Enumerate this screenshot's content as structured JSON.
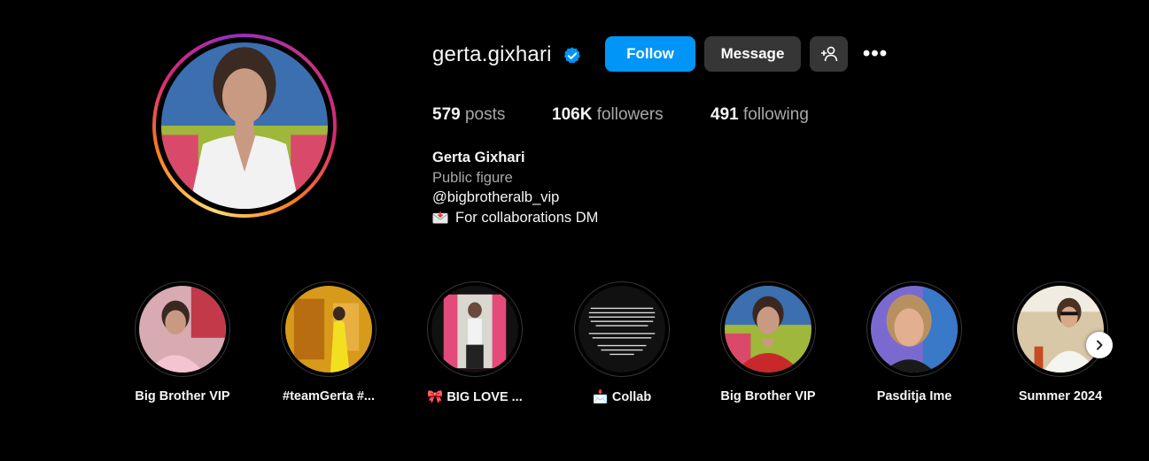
{
  "profile": {
    "username": "gerta.gixhari",
    "verified_icon": "verified-badge-icon",
    "buttons": {
      "follow": "Follow",
      "message": "Message",
      "add_user_icon": "add-user-icon",
      "more_icon": "more-options-icon",
      "more_glyph": "•••"
    },
    "stats": {
      "posts_count": "579",
      "posts_label": "posts",
      "followers_count": "106K",
      "followers_label": "followers",
      "following_count": "491",
      "following_label": "following"
    },
    "bio": {
      "name": "Gerta Gixhari",
      "category": "Public figure",
      "link": "@bigbrotheralb_vip",
      "text": "For collaborations DM"
    }
  },
  "highlights": [
    {
      "label": "Big Brother VIP"
    },
    {
      "label": "#teamGerta #..."
    },
    {
      "label": "🎀 BIG LOVE ..."
    },
    {
      "label": "📩 Collab"
    },
    {
      "label": "Big Brother VIP"
    },
    {
      "label": "Pasditja Ime"
    },
    {
      "label": "Summer 2024"
    }
  ],
  "colors": {
    "background": "#000000",
    "follow_blue": "#0095f6",
    "button_gray": "#363636",
    "muted_text": "#a8a8a8"
  }
}
